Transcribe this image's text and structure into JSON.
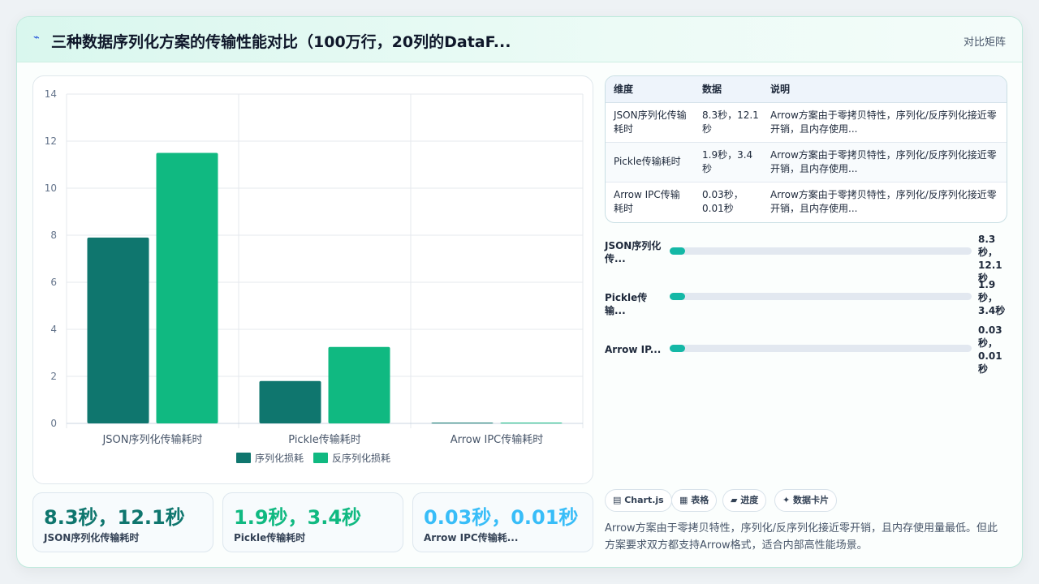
{
  "header": {
    "icon": "lightning-icon",
    "title": "三种数据序列化方案的传输性能对比（100万行，20列的DataF...",
    "right_label": "对比矩阵"
  },
  "chart_data": {
    "type": "bar",
    "categories": [
      "JSON序列化传输耗时",
      "Pickle传输耗时",
      "Arrow IPC传输耗时"
    ],
    "series": [
      {
        "name": "序列化损耗",
        "values": [
          7.9,
          1.8,
          0.03
        ],
        "color": "#0f766e"
      },
      {
        "name": "反序列化损耗",
        "values": [
          11.5,
          3.25,
          0.01
        ],
        "color": "#10b981"
      }
    ],
    "ylim": [
      0,
      14
    ],
    "yticks": [
      "0",
      "2",
      "4",
      "6",
      "8",
      "10",
      "12",
      "14"
    ],
    "legend": "bottom"
  },
  "stats": [
    {
      "value": "8.3秒，12.1秒",
      "label": "JSON序列化传输耗时",
      "color": "#0f766e"
    },
    {
      "value": "1.9秒，3.4秒",
      "label": "Pickle传输耗时",
      "color": "#10b981"
    },
    {
      "value": "0.03秒，0.01秒",
      "label": "Arrow IPC传输耗...",
      "color": "#38bdf8"
    }
  ],
  "table": {
    "headers": [
      "维度",
      "数据",
      "说明"
    ],
    "rows": [
      {
        "dim": [
          "JSON序列化传输",
          "耗时"
        ],
        "data": [
          "8.3秒，12.1",
          "秒"
        ],
        "desc": [
          "Arrow方案由于零拷贝特性，序列化/反序列化接近零",
          "开销，且内存使用..."
        ]
      },
      {
        "dim": [
          "Pickle传输耗时"
        ],
        "data": [
          "1.9秒，3.4",
          "秒"
        ],
        "desc": [
          "Arrow方案由于零拷贝特性，序列化/反序列化接近零",
          "开销，且内存使用..."
        ]
      },
      {
        "dim": [
          "Arrow IPC传输",
          "耗时"
        ],
        "data": [
          "0.03秒，",
          "0.01秒"
        ],
        "desc": [
          "Arrow方案由于零拷贝特性，序列化/反序列化接近零",
          "开销，且内存使用..."
        ]
      }
    ]
  },
  "progress": [
    {
      "label": [
        "JSON序列化",
        "传..."
      ],
      "value": [
        "8.3",
        "秒，",
        "12.1秒"
      ],
      "fraction": 0.05
    },
    {
      "label": [
        "Pickle传输..."
      ],
      "value": [
        "1.9",
        "秒，",
        "3.4秒"
      ],
      "fraction": 0.05
    },
    {
      "label": [
        "Arrow IP..."
      ],
      "value": [
        "0.03",
        "秒，",
        "0.01",
        "秒"
      ],
      "fraction": 0.05
    }
  ],
  "chips": [
    "▤ Chart.js",
    "▦ 表格",
    "▰ 进度",
    "✦ 数据卡片"
  ],
  "note": "Arrow方案由于零拷贝特性，序列化/反序列化接近零开销，且内存使用量最低。但此方案要求双方都支持Arrow格式，适合内部高性能场景。"
}
